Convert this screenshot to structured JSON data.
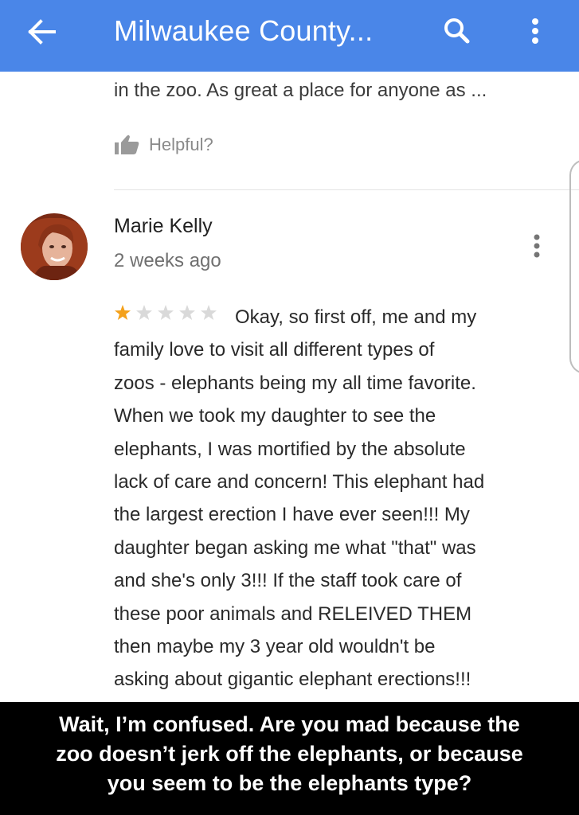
{
  "appbar": {
    "title": "Milwaukee County...",
    "back_icon": "arrow-left-icon",
    "search_icon": "search-icon",
    "more_icon": "more-vertical-icon",
    "color": "#4a86e8"
  },
  "previous_review": {
    "snippet": "in the zoo. As great a place for anyone as ...",
    "helpful_label": "Helpful?",
    "helpful_icon": "thumbs-up-icon"
  },
  "review": {
    "reviewer_name": "Marie Kelly",
    "time": "2 weeks ago",
    "rating": 1,
    "max_rating": 5,
    "star_color": "#f4a11b",
    "more_icon": "more-vertical-icon",
    "text_lines": [
      "Okay, so first off, me and my",
      "family love to visit all different types of",
      "zoos - elephants being my all time favorite.",
      "When we took my daughter to see the",
      "elephants, I was mortified by the absolute",
      "lack of care and concern! This elephant had",
      "the largest erection I have ever seen!!! My",
      "daughter began asking me what \"that\" was",
      "and she's only 3!!! If the staff took care of",
      "these poor animals and RELEIVED THEM",
      "then maybe my 3 year old wouldn't be",
      "asking about gigantic elephant erections!!!"
    ]
  },
  "caption": {
    "lines": [
      "Wait, I’m confused.  Are you mad because the",
      "zoo doesn’t jerk off the elephants, or because",
      "you seem to be the elephants type?"
    ]
  }
}
